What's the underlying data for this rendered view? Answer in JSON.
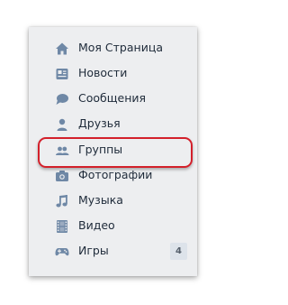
{
  "menu": {
    "accent_icon_color": "#6f88a6",
    "highlight_color": "#d3202b",
    "items": [
      {
        "label": "Моя Страница",
        "icon": "home-icon"
      },
      {
        "label": "Новости",
        "icon": "news-icon"
      },
      {
        "label": "Сообщения",
        "icon": "messages-icon"
      },
      {
        "label": "Друзья",
        "icon": "friends-icon"
      },
      {
        "label": "Группы",
        "icon": "groups-icon",
        "highlighted": true
      },
      {
        "label": "Фотографии",
        "icon": "camera-icon"
      },
      {
        "label": "Музыка",
        "icon": "music-icon"
      },
      {
        "label": "Видео",
        "icon": "video-icon"
      },
      {
        "label": "Игры",
        "icon": "gamepad-icon",
        "badge": "4"
      }
    ]
  }
}
